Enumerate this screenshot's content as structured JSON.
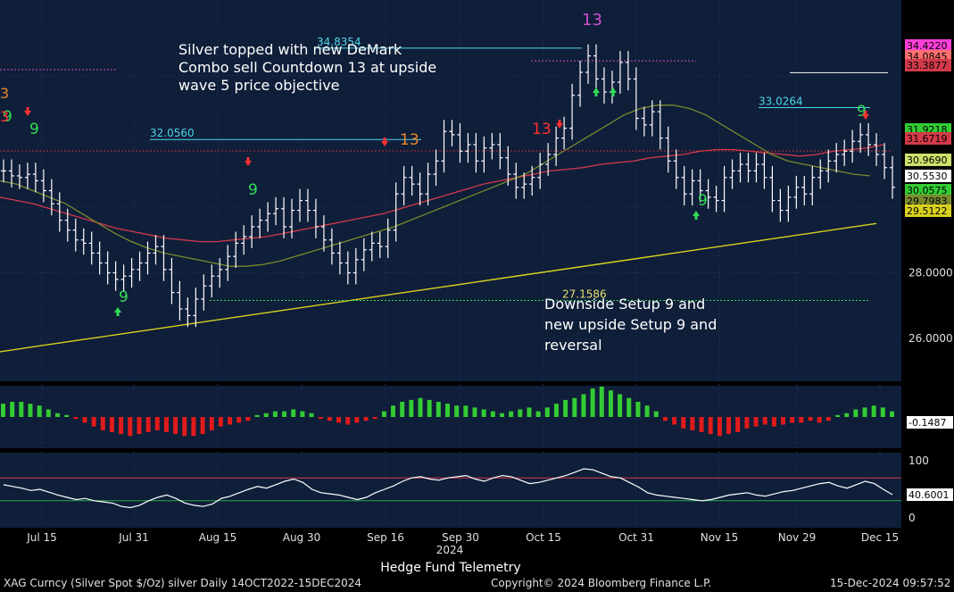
{
  "chart_data": {
    "type": "ohlc-bar",
    "colors": {
      "background": "#0f1e39",
      "price_bar": "#ffffff",
      "ma_red": "#d23a4a",
      "ma_olive": "#7a8a2e",
      "ma_yellow": "#d8d020",
      "hist_pos": "#33cc33",
      "hist_neg": "#e01b1b",
      "osc_line": "#ffffff",
      "osc_upper": "#d23a4a",
      "osc_lower": "#22aa44",
      "setup_green": "#33dd55",
      "setup_red": "#ff3030",
      "tdst_cyan": "#4fd6e8",
      "countdown_orange": "#e88a2a",
      "combo_magenta": "#d050d0"
    },
    "x_ticks": [
      "Jul 15",
      "Jul 31",
      "Aug 15",
      "Aug 30",
      "Sep 16",
      "Sep 30",
      "Oct 15",
      "Oct 31",
      "Nov 15",
      "Nov 29",
      "Dec 15"
    ],
    "year_label": "2024",
    "y_ticks": [
      "28.0000",
      "26.0000"
    ],
    "ylim": [
      24.7,
      36.3
    ],
    "price_labels": [
      {
        "value": "34.4220",
        "color": "#ff3fd8"
      },
      {
        "value": "34.0845",
        "color": "#ff7070"
      },
      {
        "value": "33.3877",
        "color": "#d23a4a"
      },
      {
        "value": "31.9218",
        "color": "#33cc33"
      },
      {
        "value": "31.6719",
        "color": "#d23a4a"
      },
      {
        "value": "30.9690",
        "color": "#cfe06a"
      },
      {
        "value": "30.5530",
        "color": "#ffffff"
      },
      {
        "value": "30.0575",
        "color": "#33cc33"
      },
      {
        "value": "29.7983",
        "color": "#7a8a2e"
      },
      {
        "value": "29.5122",
        "color": "#d8d020"
      }
    ],
    "tdst_levels": [
      {
        "label": "34.8354",
        "value": 34.8354
      },
      {
        "label": "33.0264",
        "value": 33.0264
      },
      {
        "label": "32.0560",
        "value": 32.056
      },
      {
        "label": "27.1586",
        "value": 27.1586
      }
    ],
    "annotations": [
      {
        "text": "Silver topped with new DeMark",
        "kind": "note"
      },
      {
        "text": "Combo sell Countdown 13 at upside",
        "kind": "note"
      },
      {
        "text": "wave 5 price objective",
        "kind": "note"
      },
      {
        "text": "Downside Setup 9 and",
        "kind": "note"
      },
      {
        "text": "new upside Setup 9 and",
        "kind": "note"
      },
      {
        "text": "reversal",
        "kind": "note"
      }
    ],
    "series": [
      {
        "name": "Silver spot close",
        "values": [
          31.1,
          30.95,
          30.9,
          31.0,
          30.8,
          30.5,
          30.1,
          29.6,
          29.3,
          29.0,
          28.9,
          28.6,
          28.3,
          28.0,
          27.8,
          27.9,
          28.1,
          28.3,
          28.6,
          28.8,
          28.1,
          27.4,
          26.9,
          26.7,
          27.2,
          27.6,
          27.9,
          28.1,
          28.5,
          28.9,
          29.1,
          29.4,
          29.6,
          29.8,
          29.95,
          29.4,
          29.9,
          30.2,
          29.9,
          29.4,
          29.0,
          28.6,
          28.3,
          28.0,
          28.4,
          28.7,
          28.9,
          28.8,
          29.3,
          30.4,
          30.9,
          30.7,
          30.4,
          31.0,
          31.4,
          32.3,
          32.2,
          31.7,
          31.9,
          31.4,
          31.8,
          31.9,
          31.5,
          31.0,
          30.6,
          30.7,
          30.9,
          31.3,
          31.6,
          32.1,
          32.4,
          33.4,
          34.1,
          34.6,
          33.9,
          33.5,
          33.8,
          34.4,
          33.9,
          32.7,
          32.5,
          32.9,
          32.1,
          31.4,
          30.9,
          30.4,
          30.8,
          30.5,
          30.3,
          30.2,
          30.9,
          31.1,
          31.3,
          31.1,
          31.3,
          30.9,
          30.2,
          29.9,
          30.3,
          30.6,
          30.4,
          30.9,
          31.1,
          31.4,
          31.6,
          31.7,
          32.0,
          32.2,
          31.9,
          31.6,
          31.2,
          30.6
        ]
      },
      {
        "name": "MA red",
        "values": [
          30.3,
          30.2,
          30.1,
          29.95,
          29.8,
          29.65,
          29.5,
          29.35,
          29.25,
          29.15,
          29.05,
          29.0,
          28.95,
          28.95,
          29.0,
          29.05,
          29.1,
          29.2,
          29.3,
          29.4,
          29.5,
          29.6,
          29.7,
          29.8,
          29.95,
          30.1,
          30.25,
          30.4,
          30.55,
          30.7,
          30.8,
          30.9,
          31.0,
          31.1,
          31.15,
          31.2,
          31.3,
          31.35,
          31.4,
          31.5,
          31.55,
          31.6,
          31.7,
          31.75,
          31.75,
          31.7,
          31.65,
          31.6,
          31.55,
          31.6,
          31.7,
          31.75,
          31.8,
          31.9
        ]
      },
      {
        "name": "MA olive",
        "values": [
          30.8,
          30.7,
          30.5,
          30.3,
          30.1,
          29.8,
          29.5,
          29.2,
          28.95,
          28.75,
          28.6,
          28.5,
          28.4,
          28.3,
          28.2,
          28.2,
          28.25,
          28.35,
          28.5,
          28.65,
          28.8,
          28.95,
          29.1,
          29.25,
          29.4,
          29.6,
          29.8,
          30.0,
          30.2,
          30.4,
          30.6,
          30.8,
          31.0,
          31.3,
          31.6,
          31.9,
          32.2,
          32.5,
          32.8,
          33.0,
          33.1,
          33.1,
          33.0,
          32.8,
          32.5,
          32.2,
          31.9,
          31.6,
          31.4,
          31.3,
          31.2,
          31.1,
          31.0,
          30.95
        ]
      },
      {
        "name": "MA yellow",
        "values": [
          25.6,
          25.75,
          25.9,
          26.05,
          26.2,
          26.35,
          26.5,
          26.65,
          26.8,
          26.95,
          27.1,
          27.25,
          27.4,
          27.55,
          27.7,
          27.85,
          28.0,
          28.15,
          28.3,
          28.45,
          28.6,
          28.75,
          28.9,
          29.05,
          29.2,
          29.35,
          29.5
        ]
      },
      {
        "name": "Momentum histogram",
        "values": [
          0.7,
          0.8,
          0.8,
          0.7,
          0.6,
          0.4,
          0.2,
          0.1,
          -0.1,
          -0.3,
          -0.5,
          -0.7,
          -0.8,
          -0.9,
          -1.0,
          -0.9,
          -0.8,
          -0.7,
          -0.8,
          -0.9,
          -1.0,
          -1.0,
          -0.9,
          -0.7,
          -0.5,
          -0.4,
          -0.3,
          -0.2,
          0.1,
          0.2,
          0.3,
          0.3,
          0.4,
          0.3,
          0.2,
          -0.1,
          -0.2,
          -0.3,
          -0.4,
          -0.3,
          -0.2,
          -0.1,
          0.3,
          0.6,
          0.8,
          0.9,
          1.0,
          0.9,
          0.8,
          0.7,
          0.6,
          0.6,
          0.5,
          0.4,
          0.3,
          0.2,
          0.3,
          0.4,
          0.5,
          0.3,
          0.5,
          0.7,
          0.9,
          1.0,
          1.2,
          1.5,
          1.6,
          1.4,
          1.2,
          1.0,
          0.8,
          0.6,
          0.3,
          -0.2,
          -0.4,
          -0.6,
          -0.7,
          -0.8,
          -0.9,
          -1.0,
          -0.9,
          -0.8,
          -0.6,
          -0.5,
          -0.4,
          -0.5,
          -0.4,
          -0.3,
          -0.3,
          -0.2,
          -0.3,
          -0.2,
          0.1,
          0.2,
          0.4,
          0.5,
          0.6,
          0.5,
          0.3
        ]
      },
      {
        "name": "Oscillator",
        "values": [
          58,
          55,
          52,
          48,
          50,
          45,
          40,
          36,
          32,
          34,
          30,
          28,
          26,
          20,
          18,
          22,
          30,
          36,
          40,
          34,
          26,
          22,
          20,
          24,
          34,
          38,
          44,
          50,
          55,
          52,
          58,
          64,
          68,
          62,
          50,
          44,
          42,
          40,
          36,
          32,
          36,
          44,
          50,
          56,
          64,
          70,
          72,
          68,
          66,
          70,
          72,
          74,
          68,
          64,
          70,
          74,
          72,
          66,
          60,
          62,
          66,
          70,
          74,
          80,
          86,
          84,
          78,
          72,
          70,
          62,
          54,
          44,
          40,
          38,
          36,
          34,
          32,
          30,
          32,
          36,
          40,
          42,
          44,
          40,
          38,
          42,
          46,
          48,
          52,
          56,
          60,
          62,
          56,
          52,
          58,
          64,
          60,
          50,
          40.6
        ]
      }
    ],
    "histogram_label": "-0.1487",
    "osc_axis": [
      "100",
      "0"
    ],
    "osc_label": "40.6001"
  },
  "footer": {
    "left": "XAG Curncy (Silver Spot $/Oz) silver  Daily 14OCT2022-15DEC2024",
    "center": "Copyright© 2024 Bloomberg Finance L.P.",
    "right": "15-Dec-2024 09:57:52"
  },
  "attribution": "Hedge Fund Telemetry"
}
